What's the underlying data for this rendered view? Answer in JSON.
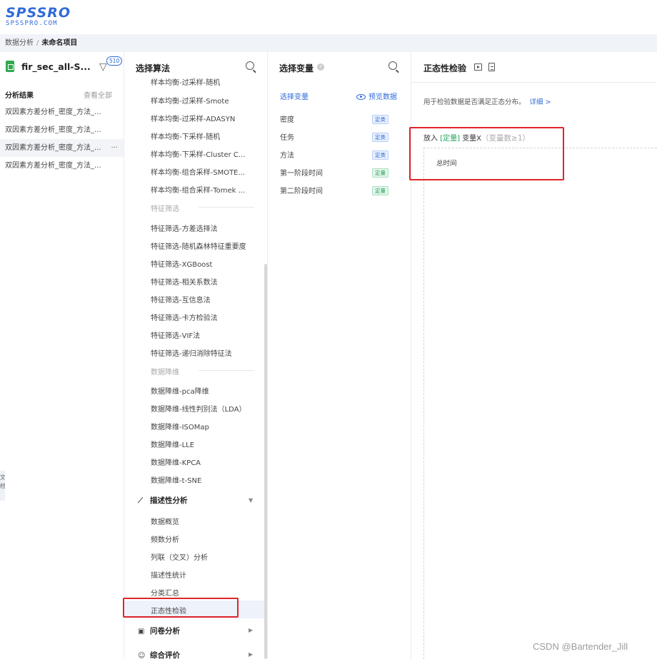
{
  "logo": {
    "main": "SPSSRO",
    "sub": "SPSSPRO.COM"
  },
  "breadcrumb": {
    "parent": "数据分析",
    "separator": "/",
    "current": "未命名项目"
  },
  "left_panel": {
    "file_name": "fir_sec_all-S...",
    "filter_badge": "510",
    "results_title": "分析结果",
    "view_all": "查看全部",
    "results": [
      "双因素方差分析_密度_方法_...",
      "双因素方差分析_密度_方法_...",
      "双因素方差分析_密度_方法_...",
      "双因素方差分析_密度_方法_..."
    ],
    "more": "···",
    "side_tab": "文 档"
  },
  "algorithm_panel": {
    "title": "选择算法",
    "items": [
      "样本均衡-过采样-随机",
      "样本均衡-过采样-Smote",
      "样本均衡-过采样-ADASYN",
      "样本均衡-下采样-随机",
      "样本均衡-下采样-Cluster C...",
      "样本均衡-组合采样-SMOTE...",
      "样本均衡-组合采样-Tomek ..."
    ],
    "section_feature": "特征筛选",
    "feature_items": [
      "特征筛选-方差选择法",
      "特征筛选-随机森林特征重要度",
      "特征筛选-XGBoost",
      "特征筛选-相关系数法",
      "特征筛选-互信息法",
      "特征筛选-卡方检验法",
      "特征筛选-VIF法",
      "特征筛选-递归消除特征法"
    ],
    "section_reduce": "数据降维",
    "reduce_items": [
      "数据降维-pca降维",
      "数据降维-线性判别法（LDA）",
      "数据降维-ISOMap",
      "数据降维-LLE",
      "数据降维-KPCA",
      "数据降维-t-SNE"
    ],
    "category_desc": "描述性分析",
    "desc_items": [
      "数据概览",
      "频数分析",
      "列联（交叉）分析",
      "描述性统计",
      "分类汇总",
      "正态性检验"
    ],
    "category_survey": "问卷分析",
    "category_eval": "综合评价"
  },
  "variable_panel": {
    "title": "选择变量",
    "select_label": "选择变量",
    "preview_label": "预览数据",
    "variables": [
      {
        "name": "密度",
        "tag": "定类",
        "kind": "blue"
      },
      {
        "name": "任务",
        "tag": "定类",
        "kind": "blue"
      },
      {
        "name": "方法",
        "tag": "定类",
        "kind": "blue"
      },
      {
        "name": "第一阶段时间",
        "tag": "定量",
        "kind": "green"
      },
      {
        "name": "第二阶段时间",
        "tag": "定量",
        "kind": "green"
      }
    ]
  },
  "config_panel": {
    "title": "正态性检验",
    "description": "用于检验数据是否满足正态分布。",
    "detail_link": "详细 >",
    "drop_prefix": "放入",
    "drop_type": "[定量]",
    "drop_var": "变量X",
    "drop_hint": "（变量数≥1）",
    "placed_variable": "总时间"
  },
  "watermark": "CSDN @Bartender_Jill",
  "colors": {
    "accent": "#2f6bd8",
    "highlight_red": "#e0242a",
    "quant_green": "#22a35a"
  }
}
